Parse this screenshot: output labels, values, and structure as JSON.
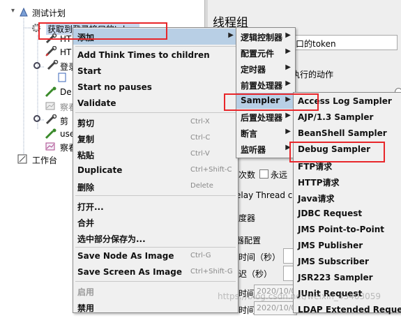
{
  "tree": {
    "root": "测试计划",
    "thread_group": "获取到登录接口的token",
    "node_http1": "HT",
    "node_http2": "HT",
    "node_login": "登录",
    "node_debug": "De",
    "node_view1": "察看",
    "node_cut": "剪",
    "node_use": "use",
    "node_view2": "察看",
    "workbench": "工作台"
  },
  "right_panel": {
    "title": "线程组",
    "name_value": "口的token",
    "action_label": "执行的动作",
    "loop_label": "次数",
    "forever_label": "永远",
    "delay_label": "elay Thread cr",
    "scheduler_label": "度器",
    "scheduler_config": "器配置",
    "duration_label": "时间（秒）",
    "delay2_label": "迟（秒）",
    "start_time_label": "时间",
    "start_time_value": "2020/10/0",
    "end_time_label": "时间",
    "end_time_value": "2020/10/0"
  },
  "context_menu": {
    "add": "添加",
    "add_think_times": "Add Think Times to children",
    "start": "Start",
    "start_no_pauses": "Start no pauses",
    "validate": "Validate",
    "cut": "剪切",
    "cut_sc": "Ctrl-X",
    "copy": "复制",
    "copy_sc": "Ctrl-C",
    "paste": "粘贴",
    "paste_sc": "Ctrl-V",
    "duplicate": "Duplicate",
    "duplicate_sc": "Ctrl+Shift-C",
    "delete": "删除",
    "delete_sc": "Delete",
    "open": "打开...",
    "merge": "合并",
    "save_selection": "选中部分保存为...",
    "save_node_image": "Save Node As Image",
    "save_node_image_sc": "Ctrl-G",
    "save_screen_image": "Save Screen As Image",
    "save_screen_image_sc": "Ctrl+Shift-G",
    "enable": "启用",
    "disable": "禁用"
  },
  "add_submenu": {
    "logic_controller": "逻辑控制器",
    "config_element": "配置元件",
    "timer": "定时器",
    "pre_processor": "前置处理器",
    "sampler": "Sampler",
    "post_processor": "后置处理器",
    "assertion": "断言",
    "listener": "监听器"
  },
  "sampler_submenu": {
    "items": [
      "Access Log Sampler",
      "AJP/1.3 Sampler",
      "BeanShell Sampler",
      "Debug Sampler",
      "FTP请求",
      "HTTP请求",
      "Java请求",
      "JDBC Request",
      "JMS Point-to-Point",
      "JMS Publisher",
      "JMS Subscriber",
      "JSR223 Sampler",
      "JUnit Request",
      "LDAP Extended Request"
    ]
  },
  "watermark": "https://blog.csdn.net/weixin_43403059",
  "colors": {
    "highlight": "#b8cfe5",
    "annotation_red": "#e8262a",
    "menu_bg": "#f0f0f0"
  }
}
